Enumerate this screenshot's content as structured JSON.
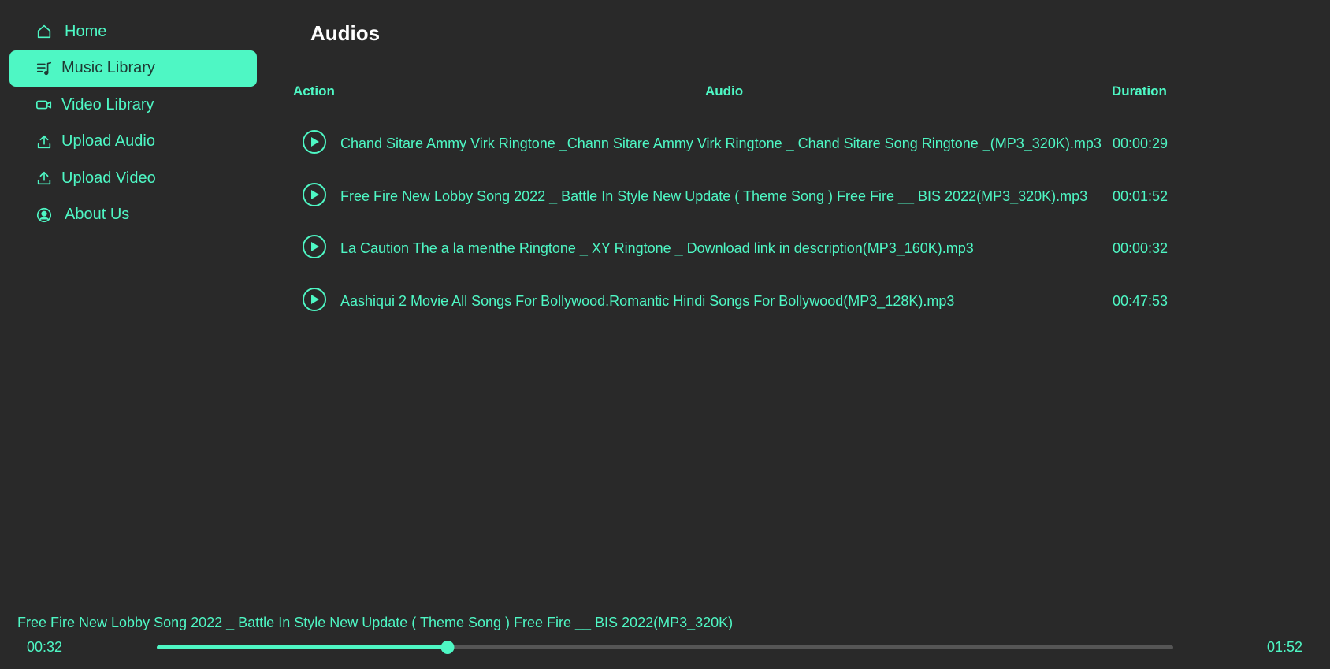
{
  "colors": {
    "accent": "#4ef7c4",
    "background": "#292929",
    "title": "#ffffff"
  },
  "sidebar": {
    "items": [
      {
        "label": "Home",
        "icon": "home-icon",
        "active": false
      },
      {
        "label": "Music Library",
        "icon": "music-list-icon",
        "active": true
      },
      {
        "label": "Video Library",
        "icon": "video-camera-icon",
        "active": false
      },
      {
        "label": "Upload Audio",
        "icon": "upload-icon",
        "active": false
      },
      {
        "label": "Upload Video",
        "icon": "upload-icon",
        "active": false
      },
      {
        "label": "About Us",
        "icon": "user-circle-icon",
        "active": false
      }
    ]
  },
  "main": {
    "title": "Audios",
    "headers": {
      "action": "Action",
      "audio": "Audio",
      "duration": "Duration"
    },
    "rows": [
      {
        "name": "Chand Sitare Ammy Virk Ringtone _Chann Sitare Ammy Virk Ringtone _ Chand Sitare Song Ringtone _(MP3_320K).mp3",
        "duration": "00:00:29"
      },
      {
        "name": "Free Fire New Lobby Song 2022 _ Battle In Style New Update ( Theme Song ) Free Fire __ BIS 2022(MP3_320K).mp3",
        "duration": "00:01:52"
      },
      {
        "name": "La Caution The a la menthe Ringtone _ XY Ringtone _ Download link in description(MP3_160K).mp3",
        "duration": "00:00:32"
      },
      {
        "name": "Aashiqui 2 Movie All Songs For Bollywood.Romantic Hindi Songs For Bollywood(MP3_128K).mp3",
        "duration": "00:47:53"
      }
    ]
  },
  "player": {
    "now_playing": "Free Fire New Lobby Song 2022 _ Battle In Style New Update ( Theme Song ) Free Fire __ BIS 2022(MP3_320K)",
    "current_time": "00:32",
    "total_time": "01:52",
    "progress": 0.286
  }
}
